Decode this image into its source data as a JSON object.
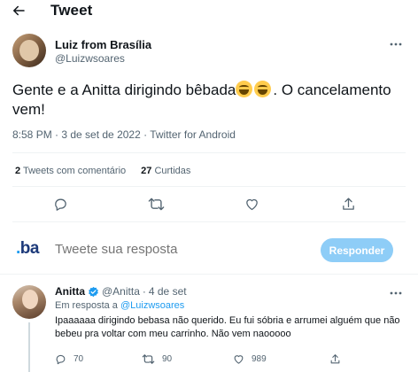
{
  "header": {
    "title": "Tweet",
    "back_icon": "arrow-left-icon"
  },
  "tweet": {
    "author_name": "Luiz from Brasília",
    "author_handle": "@Luizwsoares",
    "text_part1": "Gente e a Anitta dirigindo bêbada",
    "emojis": [
      "grinning-face-with-smiling-eyes-emoji",
      "grinning-face-with-smiling-eyes-emoji"
    ],
    "text_part2": ". O cancelamento vem!",
    "meta": "8:58 PM · 3 de set de 2022 · Twitter for Android",
    "stats": {
      "retweets_count": "2",
      "retweets_label": "Tweets com comentário",
      "likes_count": "27",
      "likes_label": "Curtidas"
    },
    "actions": [
      "comment-icon",
      "retweet-icon",
      "like-icon",
      "share-icon"
    ]
  },
  "reply_box": {
    "logo_dot": ".",
    "logo_text": "ba",
    "placeholder": "Tweete sua resposta",
    "button_label": "Responder"
  },
  "reply": {
    "author_name": "Anitta",
    "author_handle": "@Anitta",
    "separator": "·",
    "date": "4 de set",
    "replying_prefix": "Em resposta a",
    "replying_to": "@Luizwsoares",
    "text": "Ipaaaaaa dirigindo bebasa não querido. Eu fui sóbria e arrumei alguém que não bebeu pra voltar com meu carrinho. Não vem naooooo",
    "replies": "70",
    "retweets": "90",
    "likes": "989"
  },
  "colors": {
    "accent": "#1d9bf0",
    "reply_button_disabled": "#8ecdf7",
    "secondary_text": "#536471",
    "primary_text": "#0f1419",
    "divider": "#eff3f4"
  }
}
